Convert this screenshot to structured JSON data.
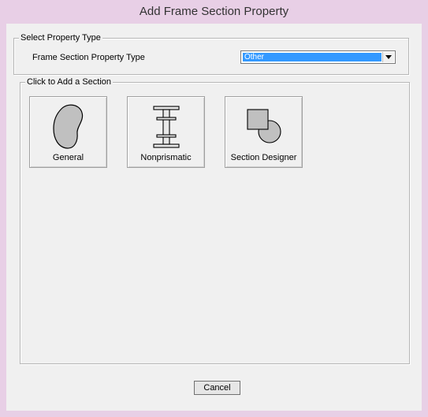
{
  "window": {
    "title": "Add Frame Section Property"
  },
  "select_group": {
    "legend": "Select Property Type",
    "field_label": "Frame Section Property Type",
    "selected_value": "Other"
  },
  "add_group": {
    "legend": "Click to Add a Section",
    "buttons": [
      {
        "label": "General",
        "icon": "general-shape-icon"
      },
      {
        "label": "Nonprismatic",
        "icon": "i-beam-icon"
      },
      {
        "label": "Section Designer",
        "icon": "section-designer-icon"
      }
    ]
  },
  "footer": {
    "cancel_label": "Cancel"
  }
}
